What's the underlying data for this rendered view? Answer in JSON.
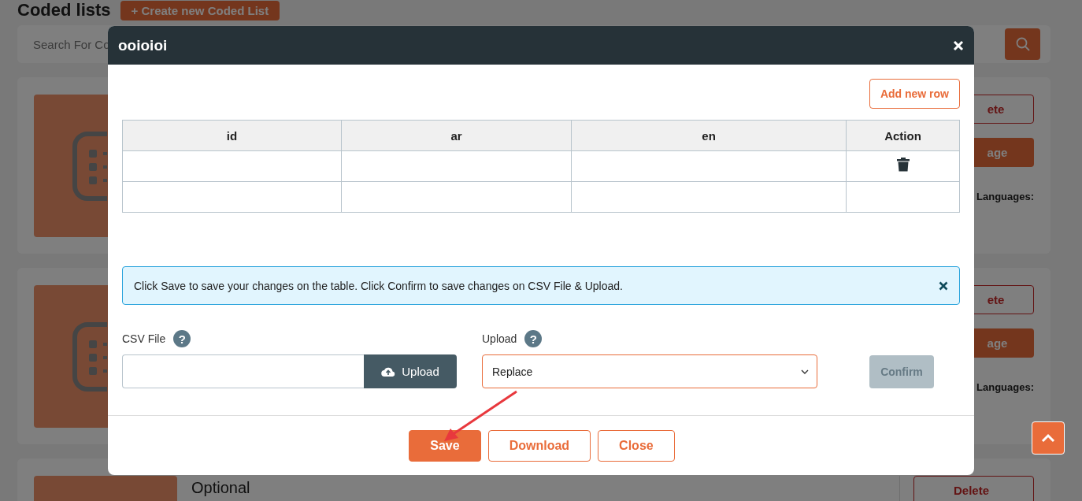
{
  "page": {
    "title": "Coded lists",
    "create_button": "+ Create new Coded List",
    "search_placeholder": "Search For Co"
  },
  "cards": [
    {
      "delete": "ete",
      "manage": "age",
      "languages_label": "Languages:"
    },
    {
      "delete": "ete",
      "manage": "age",
      "languages_label": "Languages:"
    },
    {
      "title": "Optional",
      "delete": "Delete"
    }
  ],
  "modal": {
    "title": "ooioioi",
    "add_row_button": "Add new row",
    "table": {
      "columns": [
        "id",
        "ar",
        "en",
        "Action"
      ],
      "rows": [
        {
          "delete_icon": true
        },
        {
          "delete_icon": false
        }
      ]
    },
    "alert": {
      "text": "Click Save to save your changes on the table. Click Confirm to save changes on CSV File & Upload."
    },
    "csv_label": "CSV File",
    "csv_help": "?",
    "upload_button": "Upload",
    "upload_label": "Upload",
    "upload_help": "?",
    "upload_select": "Replace",
    "confirm_button": {
      "label": "Confirm",
      "disabled": true
    },
    "footer_buttons": [
      {
        "label": "Save",
        "kind": "primary"
      },
      {
        "label": "Download",
        "kind": "outline"
      },
      {
        "label": "Close",
        "kind": "outline"
      }
    ]
  }
}
